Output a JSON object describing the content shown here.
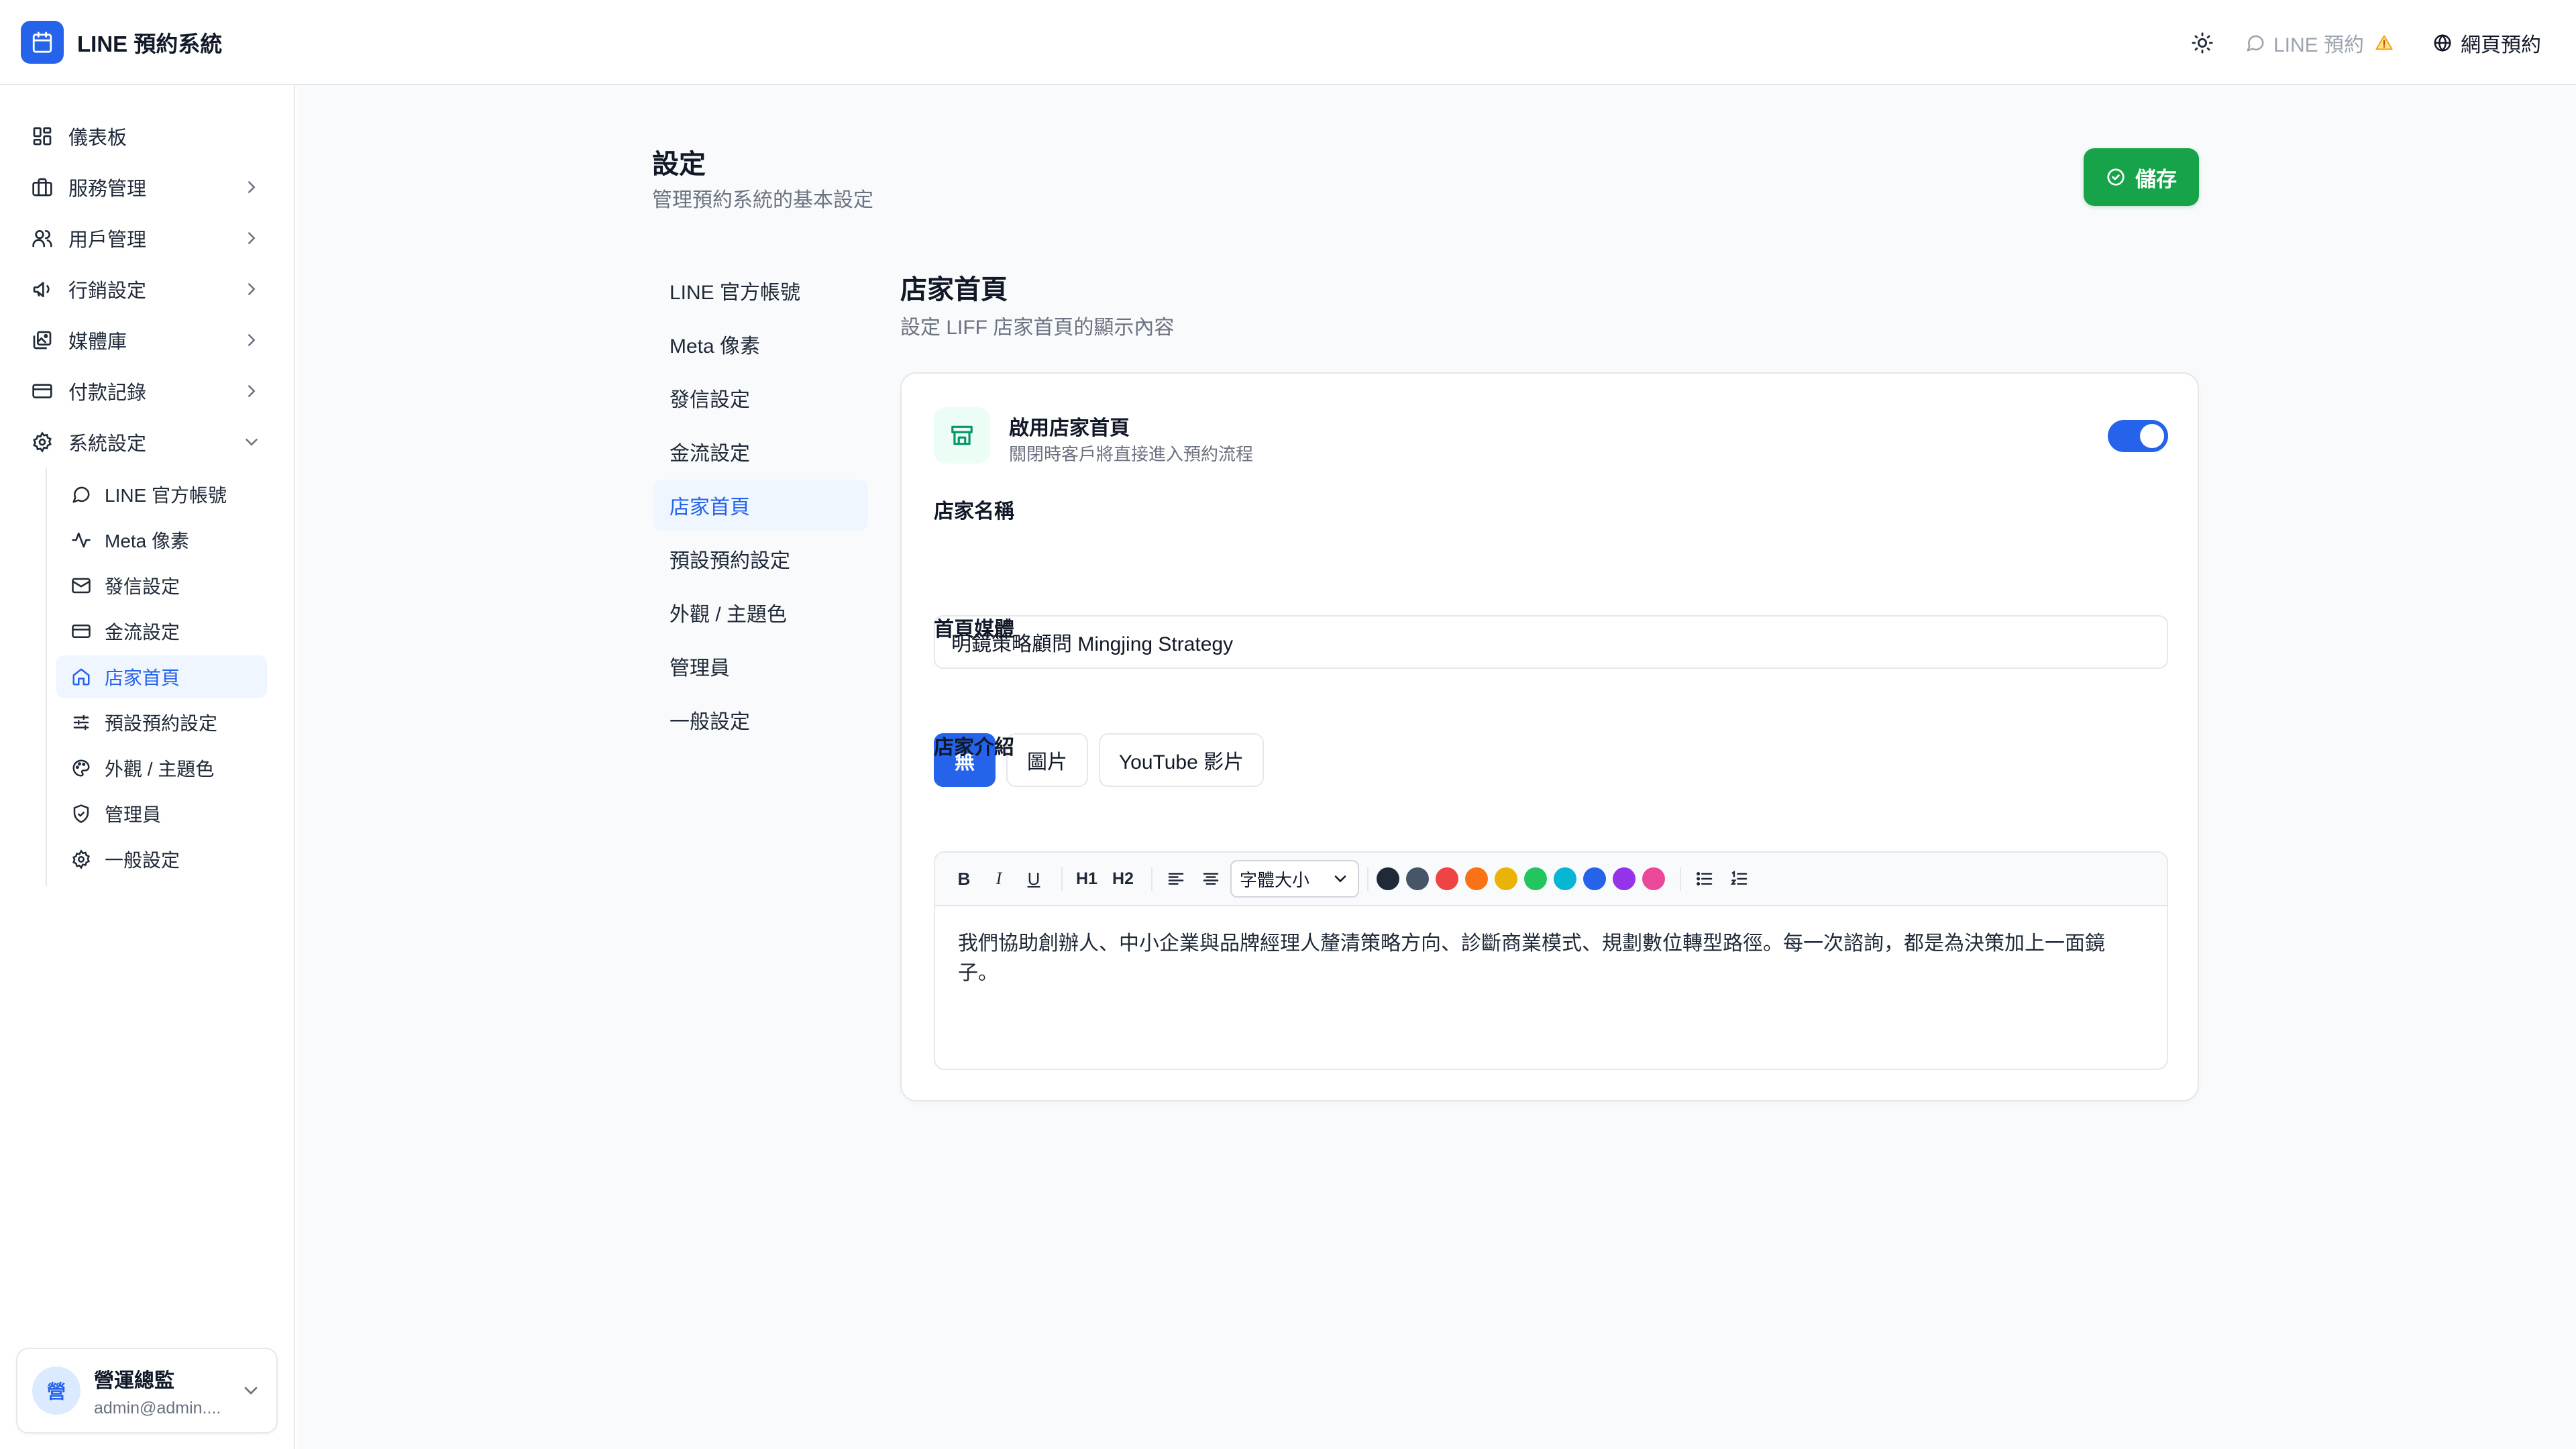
{
  "app": {
    "title": "LINE 預約系統"
  },
  "header": {
    "line_link": "LINE 預約",
    "web_link": "網頁預約"
  },
  "sidebar": {
    "items": [
      {
        "label": "儀表板",
        "icon": "dashboard-icon"
      },
      {
        "label": "服務管理",
        "icon": "briefcase-icon"
      },
      {
        "label": "用戶管理",
        "icon": "users-icon"
      },
      {
        "label": "行銷設定",
        "icon": "megaphone-icon"
      },
      {
        "label": "媒體庫",
        "icon": "images-icon"
      },
      {
        "label": "付款記錄",
        "icon": "credit-card-icon"
      },
      {
        "label": "系統設定",
        "icon": "gear-icon"
      }
    ],
    "sub_items": [
      {
        "label": "LINE 官方帳號",
        "icon": "chat-bubble-icon"
      },
      {
        "label": "Meta 像素",
        "icon": "activity-icon"
      },
      {
        "label": "發信設定",
        "icon": "mail-icon"
      },
      {
        "label": "金流設定",
        "icon": "credit-card-icon"
      },
      {
        "label": "店家首頁",
        "icon": "home-icon",
        "active": true
      },
      {
        "label": "預設預約設定",
        "icon": "sliders-icon"
      },
      {
        "label": "外觀 / 主題色",
        "icon": "palette-icon"
      },
      {
        "label": "管理員",
        "icon": "shield-icon"
      },
      {
        "label": "一般設定",
        "icon": "cog-icon"
      }
    ],
    "user": {
      "avatar": "營",
      "name": "營運總監",
      "email": "admin@admin...."
    }
  },
  "page": {
    "title": "設定",
    "subtitle": "管理預約系統的基本設定",
    "save_label": "儲存"
  },
  "settings_nav": [
    "LINE 官方帳號",
    "Meta 像素",
    "發信設定",
    "金流設定",
    "店家首頁",
    "預設預約設定",
    "外觀 / 主題色",
    "管理員",
    "一般設定"
  ],
  "settings_nav_active": "店家首頁",
  "section": {
    "title": "店家首頁",
    "subtitle": "設定 LIFF 店家首頁的顯示內容",
    "enable": {
      "title": "啟用店家首頁",
      "desc": "關閉時客戶將直接進入預約流程",
      "enabled": true
    },
    "store_name": {
      "label": "店家名稱",
      "value": "明鏡策略顧問 Mingjing Strategy"
    },
    "media": {
      "label": "首頁媒體",
      "options": [
        "無",
        "圖片",
        "YouTube 影片"
      ],
      "selected": "無"
    },
    "intro": {
      "label": "店家介紹",
      "toolbar": {
        "bold": "B",
        "italic": "I",
        "underline": "U",
        "h1": "H1",
        "h2": "H2",
        "font_size": "字體大小"
      },
      "colors": [
        "#1f2937",
        "#475569",
        "#ef4444",
        "#f97316",
        "#eab308",
        "#22c55e",
        "#06b6d4",
        "#2563eb",
        "#9333ea",
        "#ec4899"
      ],
      "content": "我們協助創辦人、中小企業與品牌經理人釐清策略方向、診斷商業模式、規劃數位轉型路徑。每一次諮詢，都是為決策加上一面鏡子。"
    }
  },
  "colors": {
    "primary": "#2563eb",
    "success": "#16a34a",
    "warning": "#f59e0b"
  }
}
